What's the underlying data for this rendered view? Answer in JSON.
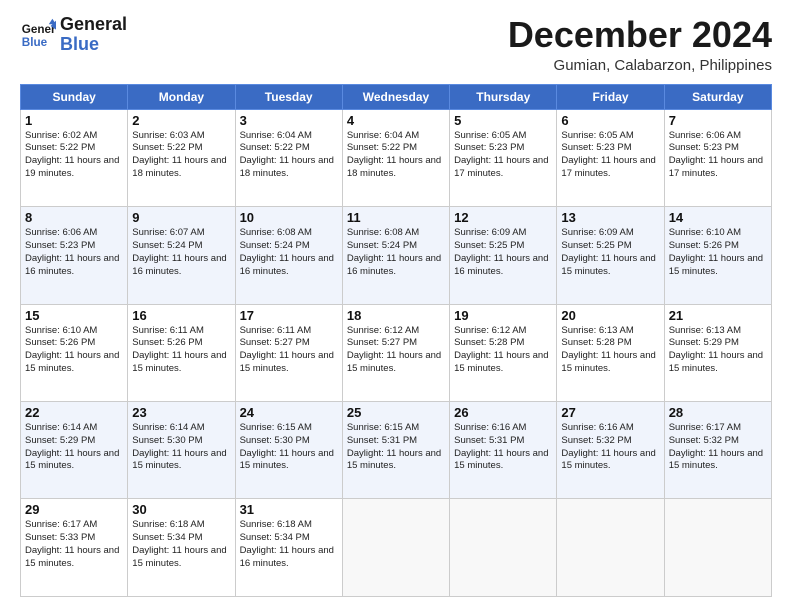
{
  "logo": {
    "line1": "General",
    "line2": "Blue"
  },
  "title": "December 2024",
  "location": "Gumian, Calabarzon, Philippines",
  "days_of_week": [
    "Sunday",
    "Monday",
    "Tuesday",
    "Wednesday",
    "Thursday",
    "Friday",
    "Saturday"
  ],
  "weeks": [
    [
      {
        "day": 1,
        "sunrise": "6:02 AM",
        "sunset": "5:22 PM",
        "daylight": "11 hours and 19 minutes."
      },
      {
        "day": 2,
        "sunrise": "6:03 AM",
        "sunset": "5:22 PM",
        "daylight": "11 hours and 18 minutes."
      },
      {
        "day": 3,
        "sunrise": "6:04 AM",
        "sunset": "5:22 PM",
        "daylight": "11 hours and 18 minutes."
      },
      {
        "day": 4,
        "sunrise": "6:04 AM",
        "sunset": "5:22 PM",
        "daylight": "11 hours and 18 minutes."
      },
      {
        "day": 5,
        "sunrise": "6:05 AM",
        "sunset": "5:23 PM",
        "daylight": "11 hours and 17 minutes."
      },
      {
        "day": 6,
        "sunrise": "6:05 AM",
        "sunset": "5:23 PM",
        "daylight": "11 hours and 17 minutes."
      },
      {
        "day": 7,
        "sunrise": "6:06 AM",
        "sunset": "5:23 PM",
        "daylight": "11 hours and 17 minutes."
      }
    ],
    [
      {
        "day": 8,
        "sunrise": "6:06 AM",
        "sunset": "5:23 PM",
        "daylight": "11 hours and 16 minutes."
      },
      {
        "day": 9,
        "sunrise": "6:07 AM",
        "sunset": "5:24 PM",
        "daylight": "11 hours and 16 minutes."
      },
      {
        "day": 10,
        "sunrise": "6:08 AM",
        "sunset": "5:24 PM",
        "daylight": "11 hours and 16 minutes."
      },
      {
        "day": 11,
        "sunrise": "6:08 AM",
        "sunset": "5:24 PM",
        "daylight": "11 hours and 16 minutes."
      },
      {
        "day": 12,
        "sunrise": "6:09 AM",
        "sunset": "5:25 PM",
        "daylight": "11 hours and 16 minutes."
      },
      {
        "day": 13,
        "sunrise": "6:09 AM",
        "sunset": "5:25 PM",
        "daylight": "11 hours and 15 minutes."
      },
      {
        "day": 14,
        "sunrise": "6:10 AM",
        "sunset": "5:26 PM",
        "daylight": "11 hours and 15 minutes."
      }
    ],
    [
      {
        "day": 15,
        "sunrise": "6:10 AM",
        "sunset": "5:26 PM",
        "daylight": "11 hours and 15 minutes."
      },
      {
        "day": 16,
        "sunrise": "6:11 AM",
        "sunset": "5:26 PM",
        "daylight": "11 hours and 15 minutes."
      },
      {
        "day": 17,
        "sunrise": "6:11 AM",
        "sunset": "5:27 PM",
        "daylight": "11 hours and 15 minutes."
      },
      {
        "day": 18,
        "sunrise": "6:12 AM",
        "sunset": "5:27 PM",
        "daylight": "11 hours and 15 minutes."
      },
      {
        "day": 19,
        "sunrise": "6:12 AM",
        "sunset": "5:28 PM",
        "daylight": "11 hours and 15 minutes."
      },
      {
        "day": 20,
        "sunrise": "6:13 AM",
        "sunset": "5:28 PM",
        "daylight": "11 hours and 15 minutes."
      },
      {
        "day": 21,
        "sunrise": "6:13 AM",
        "sunset": "5:29 PM",
        "daylight": "11 hours and 15 minutes."
      }
    ],
    [
      {
        "day": 22,
        "sunrise": "6:14 AM",
        "sunset": "5:29 PM",
        "daylight": "11 hours and 15 minutes."
      },
      {
        "day": 23,
        "sunrise": "6:14 AM",
        "sunset": "5:30 PM",
        "daylight": "11 hours and 15 minutes."
      },
      {
        "day": 24,
        "sunrise": "6:15 AM",
        "sunset": "5:30 PM",
        "daylight": "11 hours and 15 minutes."
      },
      {
        "day": 25,
        "sunrise": "6:15 AM",
        "sunset": "5:31 PM",
        "daylight": "11 hours and 15 minutes."
      },
      {
        "day": 26,
        "sunrise": "6:16 AM",
        "sunset": "5:31 PM",
        "daylight": "11 hours and 15 minutes."
      },
      {
        "day": 27,
        "sunrise": "6:16 AM",
        "sunset": "5:32 PM",
        "daylight": "11 hours and 15 minutes."
      },
      {
        "day": 28,
        "sunrise": "6:17 AM",
        "sunset": "5:32 PM",
        "daylight": "11 hours and 15 minutes."
      }
    ],
    [
      {
        "day": 29,
        "sunrise": "6:17 AM",
        "sunset": "5:33 PM",
        "daylight": "11 hours and 15 minutes."
      },
      {
        "day": 30,
        "sunrise": "6:18 AM",
        "sunset": "5:34 PM",
        "daylight": "11 hours and 15 minutes."
      },
      {
        "day": 31,
        "sunrise": "6:18 AM",
        "sunset": "5:34 PM",
        "daylight": "11 hours and 16 minutes."
      },
      null,
      null,
      null,
      null
    ]
  ]
}
